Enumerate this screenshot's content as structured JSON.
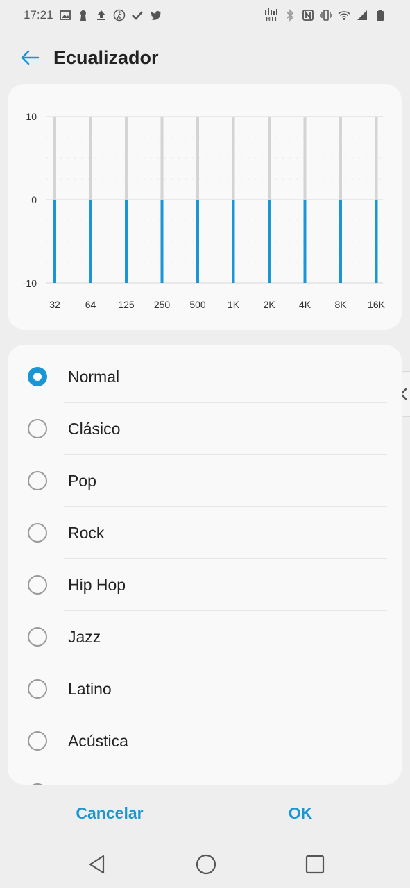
{
  "status_bar": {
    "time": "17:21",
    "hifi_label": "HIFI",
    "icons_left": [
      "image-icon",
      "keyhole-icon",
      "upload-icon",
      "walking-icon",
      "check-icon",
      "twitter-icon"
    ],
    "icons_right": [
      "hifi-icon",
      "bluetooth-icon",
      "nfc-icon",
      "vibrate-icon",
      "wifi-icon",
      "signal-icon",
      "battery-icon"
    ]
  },
  "header": {
    "title": "Ecualizador",
    "back_icon": "arrow-left-icon"
  },
  "chart_data": {
    "type": "bar",
    "categories": [
      "32",
      "64",
      "125",
      "250",
      "500",
      "1K",
      "2K",
      "4K",
      "8K",
      "16K"
    ],
    "values": [
      -10,
      -10,
      -10,
      -10,
      -10,
      -10,
      -10,
      -10,
      -10,
      -10
    ],
    "baseline_values": [
      0,
      0,
      0,
      0,
      0,
      0,
      0,
      0,
      0,
      0
    ],
    "ylim": [
      -10,
      10
    ],
    "yticks": [
      "10",
      "0",
      "-10"
    ],
    "colors": {
      "active": "#1a96d4",
      "track": "#d4d4d4"
    }
  },
  "presets": {
    "selected": "Normal",
    "items": [
      {
        "label": "Normal",
        "checked": true
      },
      {
        "label": "Clásico",
        "checked": false
      },
      {
        "label": "Pop",
        "checked": false
      },
      {
        "label": "Rock",
        "checked": false
      },
      {
        "label": "Hip Hop",
        "checked": false
      },
      {
        "label": "Jazz",
        "checked": false
      },
      {
        "label": "Latino",
        "checked": false
      },
      {
        "label": "Acústica",
        "checked": false
      }
    ]
  },
  "actions": {
    "cancel_label": "Cancelar",
    "ok_label": "OK"
  },
  "nav_bar": {
    "icons": [
      "back-triangle-icon",
      "home-circle-icon",
      "recents-square-icon"
    ]
  },
  "colors": {
    "accent": "#1a96d4",
    "background": "#eeeeee",
    "card": "#f9f9f9"
  }
}
